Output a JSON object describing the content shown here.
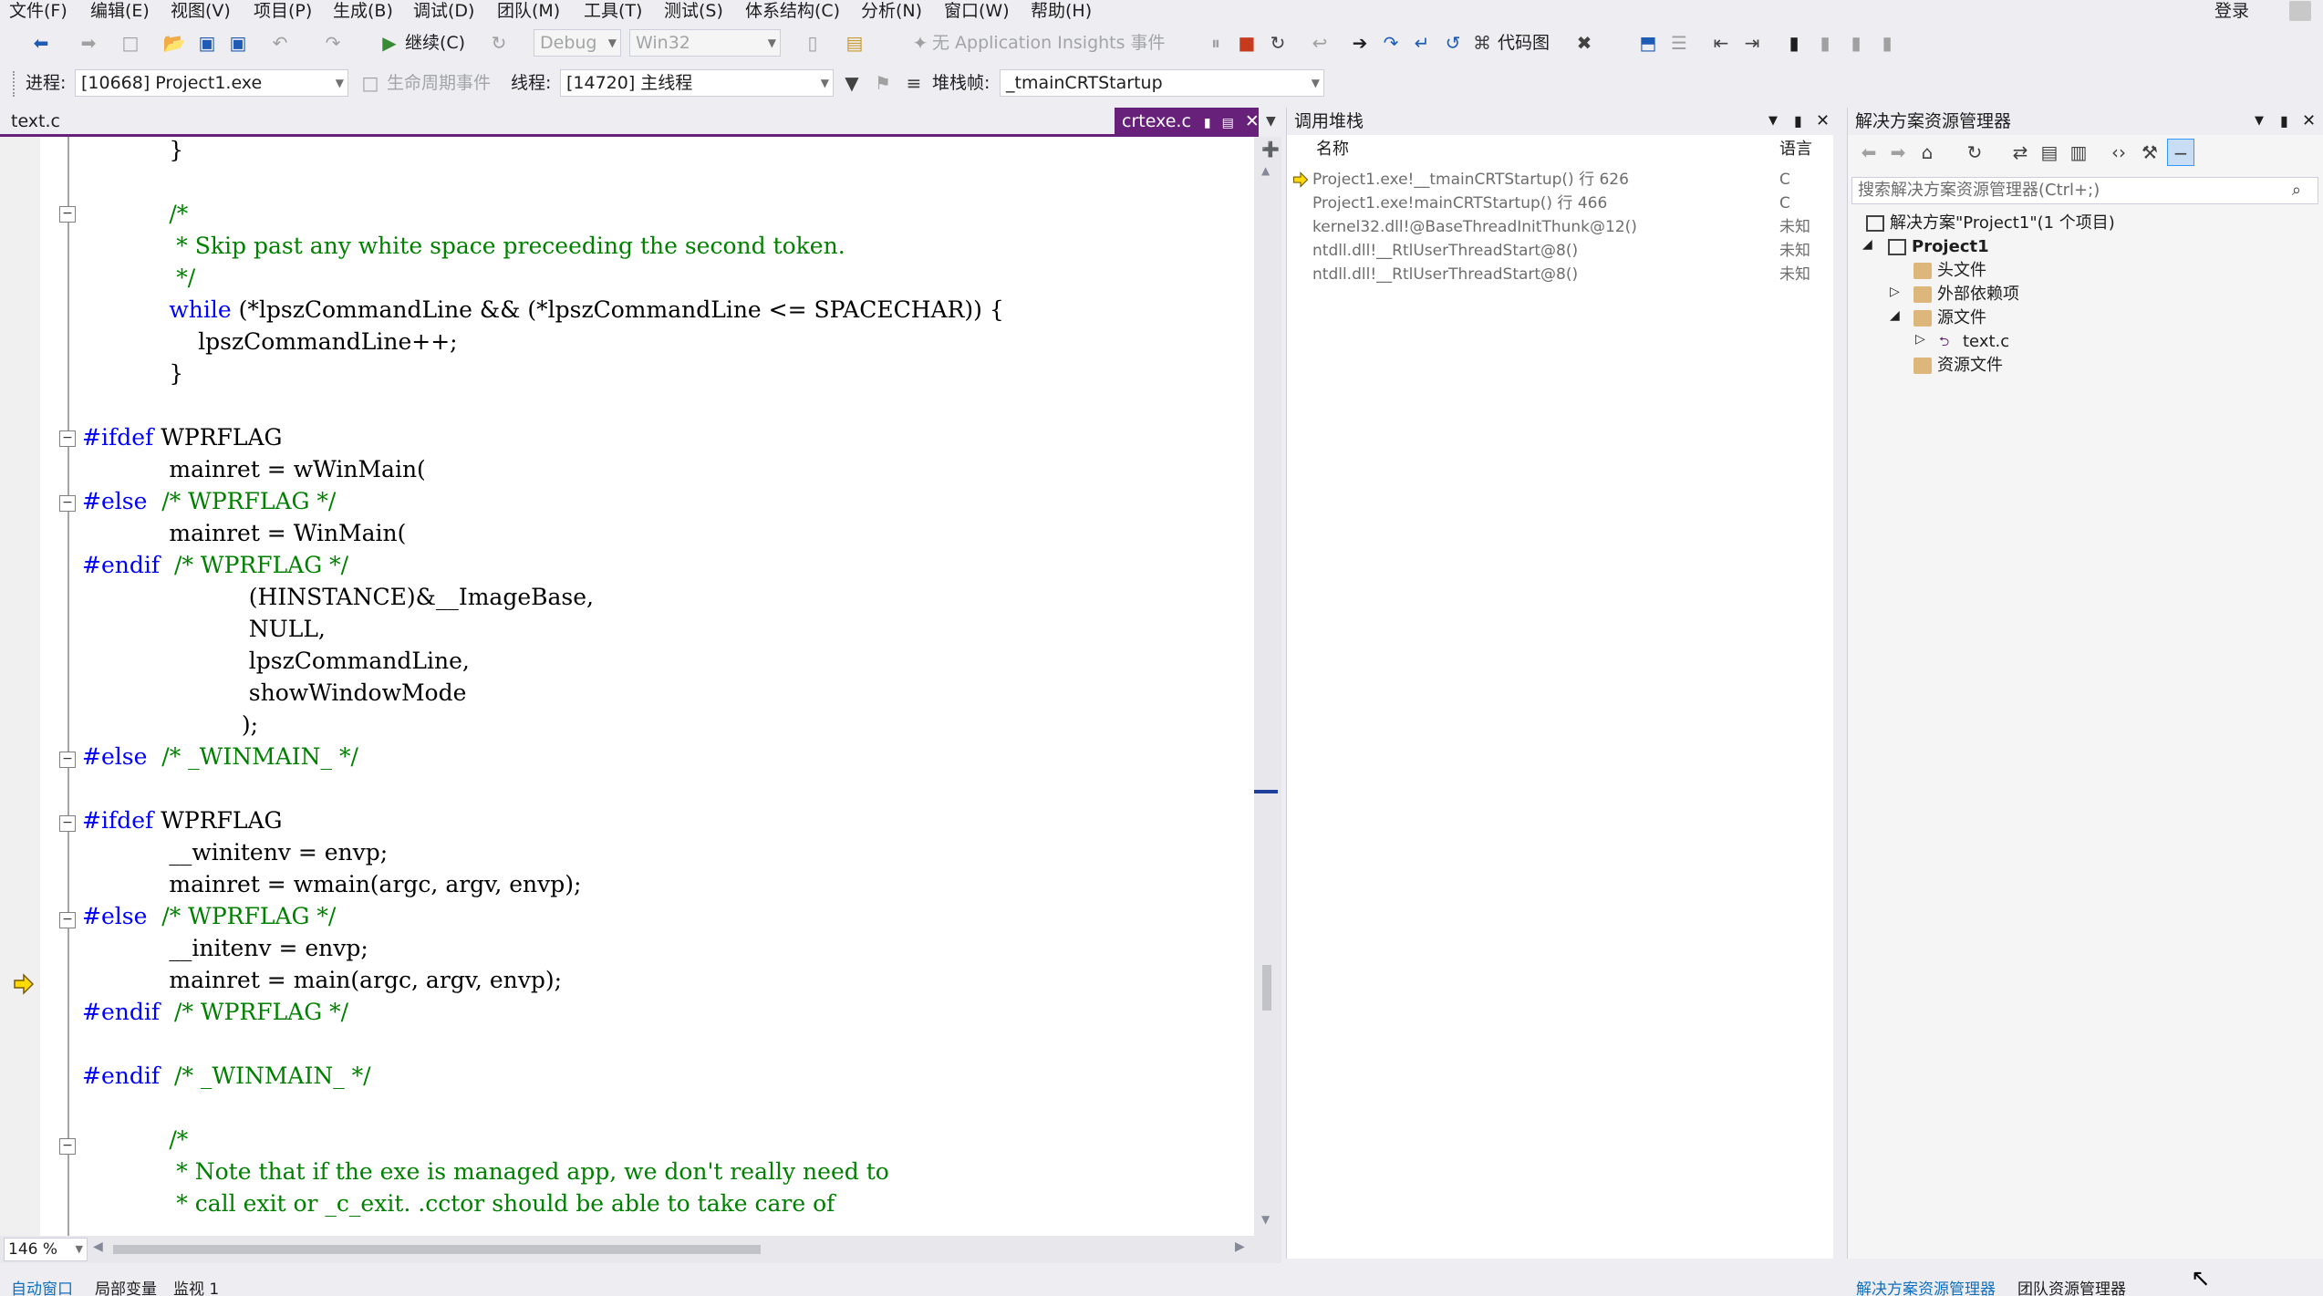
{
  "menu": {
    "items": [
      "文件(F)",
      "编辑(E)",
      "视图(V)",
      "项目(P)",
      "生成(B)",
      "调试(D)",
      "团队(M)",
      "工具(T)",
      "测试(S)",
      "体系结构(C)",
      "分析(N)",
      "窗口(W)",
      "帮助(H)"
    ],
    "login": "登录"
  },
  "toolbar1": {
    "continue_label": "继续(C)",
    "config": "Debug",
    "platform": "Win32",
    "insights": "无 Application Insights 事件",
    "codemap": "代码图"
  },
  "toolbar2": {
    "process_label": "进程:",
    "process_value": "[10668] Project1.exe",
    "lifecycle_label": "生命周期事件",
    "thread_label": "线程:",
    "thread_value": "[14720] 主线程",
    "stackframe_label": "堆栈帧:",
    "stackframe_value": "_tmainCRTStartup"
  },
  "editor": {
    "left_tab": "text.c",
    "active_tab": "crtexe.c",
    "zoom": "146 %",
    "lines": [
      "            }",
      "",
      "            /*",
      "             * Skip past any white space preceeding the second token.",
      "             */",
      "            while (*lpszCommandLine && (*lpszCommandLine <= SPACECHAR)) {",
      "                lpszCommandLine++;",
      "            }",
      "",
      "#ifdef WPRFLAG",
      "            mainret = wWinMain(",
      "#else  /* WPRFLAG */",
      "            mainret = WinMain(",
      "#endif  /* WPRFLAG */",
      "                       (HINSTANCE)&__ImageBase,",
      "                       NULL,",
      "                       lpszCommandLine,",
      "                       showWindowMode",
      "                      );",
      "#else  /* _WINMAIN_ */",
      "",
      "#ifdef WPRFLAG",
      "            __winitenv = envp;",
      "            mainret = wmain(argc, argv, envp);",
      "#else  /* WPRFLAG */",
      "            __initenv = envp;",
      "            mainret = main(argc, argv, envp);",
      "#endif  /* WPRFLAG */",
      "",
      "#endif  /* _WINMAIN_ */",
      "",
      "            /*",
      "             * Note that if the exe is managed app, we don't really need to",
      "             * call exit or _c_exit. .cctor should be able to take care of"
    ]
  },
  "callstack": {
    "title": "调用堆栈",
    "col_name": "名称",
    "col_lang": "语言",
    "rows": [
      {
        "name": "Project1.exe!__tmainCRTStartup() 行 626",
        "lang": "C"
      },
      {
        "name": "Project1.exe!mainCRTStartup() 行 466",
        "lang": "C"
      },
      {
        "name": "kernel32.dll!@BaseThreadInitThunk@12()",
        "lang": "未知"
      },
      {
        "name": "ntdll.dll!__RtlUserThreadStart@8()",
        "lang": "未知"
      },
      {
        "name": "ntdll.dll!__RtlUserThreadStart@8()",
        "lang": "未知"
      }
    ]
  },
  "solution": {
    "title": "解决方案资源管理器",
    "search_placeholder": "搜索解决方案资源管理器(Ctrl+;)",
    "solution_label": "解决方案\"Project1\"(1 个项目)",
    "project": "Project1",
    "items": [
      "头文件",
      "外部依赖项",
      "源文件",
      "text.c",
      "资源文件"
    ]
  },
  "bottom": {
    "left_tabs": [
      "自动窗口",
      "局部变量",
      "监视 1"
    ],
    "right_tabs": [
      "解决方案资源管理器",
      "团队资源管理器"
    ]
  }
}
